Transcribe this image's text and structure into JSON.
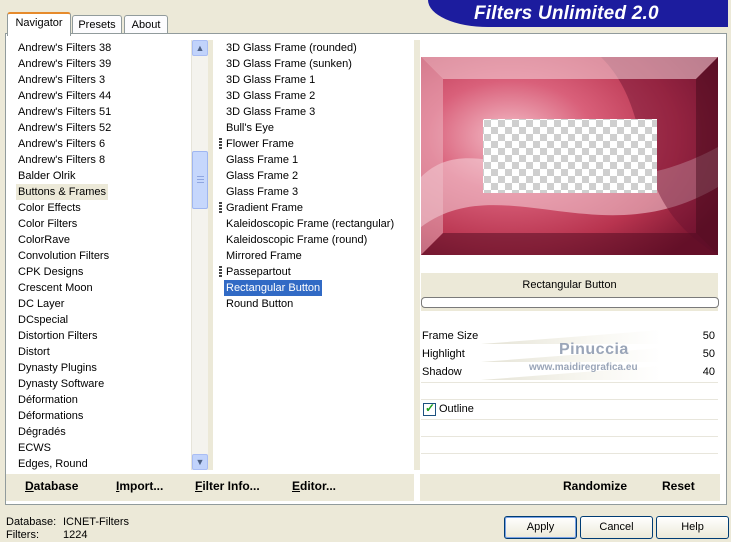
{
  "header": {
    "title": "Filters Unlimited 2.0"
  },
  "tabs": [
    {
      "label": "Navigator",
      "active": true
    },
    {
      "label": "Presets",
      "active": false
    },
    {
      "label": "About",
      "active": false
    }
  ],
  "categories": {
    "items": [
      "Andrew's Filters 38",
      "Andrew's Filters 39",
      "Andrew's Filters 3",
      "Andrew's Filters 44",
      "Andrew's Filters 51",
      "Andrew's Filters 52",
      "Andrew's Filters 6",
      "Andrew's Filters 8",
      "Balder Olrik",
      "Buttons & Frames",
      "Color Effects",
      "Color Filters",
      "ColorRave",
      "Convolution Filters",
      "CPK Designs",
      "Crescent Moon",
      "DC Layer",
      "DCspecial",
      "Distortion Filters",
      "Distort",
      "Dynasty Plugins",
      "Dynasty Software",
      "Déformation",
      "Déformations",
      "Dégradés",
      "ECWS",
      "Edges, Round"
    ],
    "selected": "Buttons & Frames"
  },
  "filters": {
    "items": [
      "3D Glass Frame (rounded)",
      "3D Glass Frame (sunken)",
      "3D Glass Frame 1",
      "3D Glass Frame 2",
      "3D Glass Frame 3",
      "Bull's Eye",
      "Flower Frame",
      "Glass Frame 1",
      "Glass Frame 2",
      "Glass Frame 3",
      "Gradient Frame",
      "Kaleidoscopic Frame (rectangular)",
      "Kaleidoscopic Frame (round)",
      "Mirrored Frame",
      "Passepartout",
      "Rectangular Button",
      "Round Button"
    ],
    "marked": [
      "Flower Frame",
      "Gradient Frame",
      "Passepartout"
    ],
    "selected": "Rectangular Button"
  },
  "preview": {
    "caption": "Rectangular Button",
    "accent": "#c0445c"
  },
  "params": [
    {
      "label": "Frame Size",
      "value": "50"
    },
    {
      "label": "Highlight",
      "value": "50"
    },
    {
      "label": "Shadow",
      "value": "40"
    }
  ],
  "outline": {
    "label": "Outline",
    "checked": true
  },
  "watermark": {
    "name": "Pinuccia",
    "url": "www.maidiregrafica.eu"
  },
  "toolbar": {
    "database": "Database",
    "import": "Import...",
    "filter_info": "Filter Info...",
    "editor": "Editor...",
    "randomize": "Randomize",
    "reset": "Reset"
  },
  "status": {
    "database_label": "Database:",
    "database_value": "ICNET-Filters",
    "filters_label": "Filters:",
    "filters_value": "1224"
  },
  "buttons": {
    "apply": "Apply",
    "cancel": "Cancel",
    "help": "Help"
  },
  "icons": {
    "scroll_up": "arrow-up-icon",
    "scroll_down": "arrow-down-icon",
    "checkmark": "checkmark-icon"
  }
}
